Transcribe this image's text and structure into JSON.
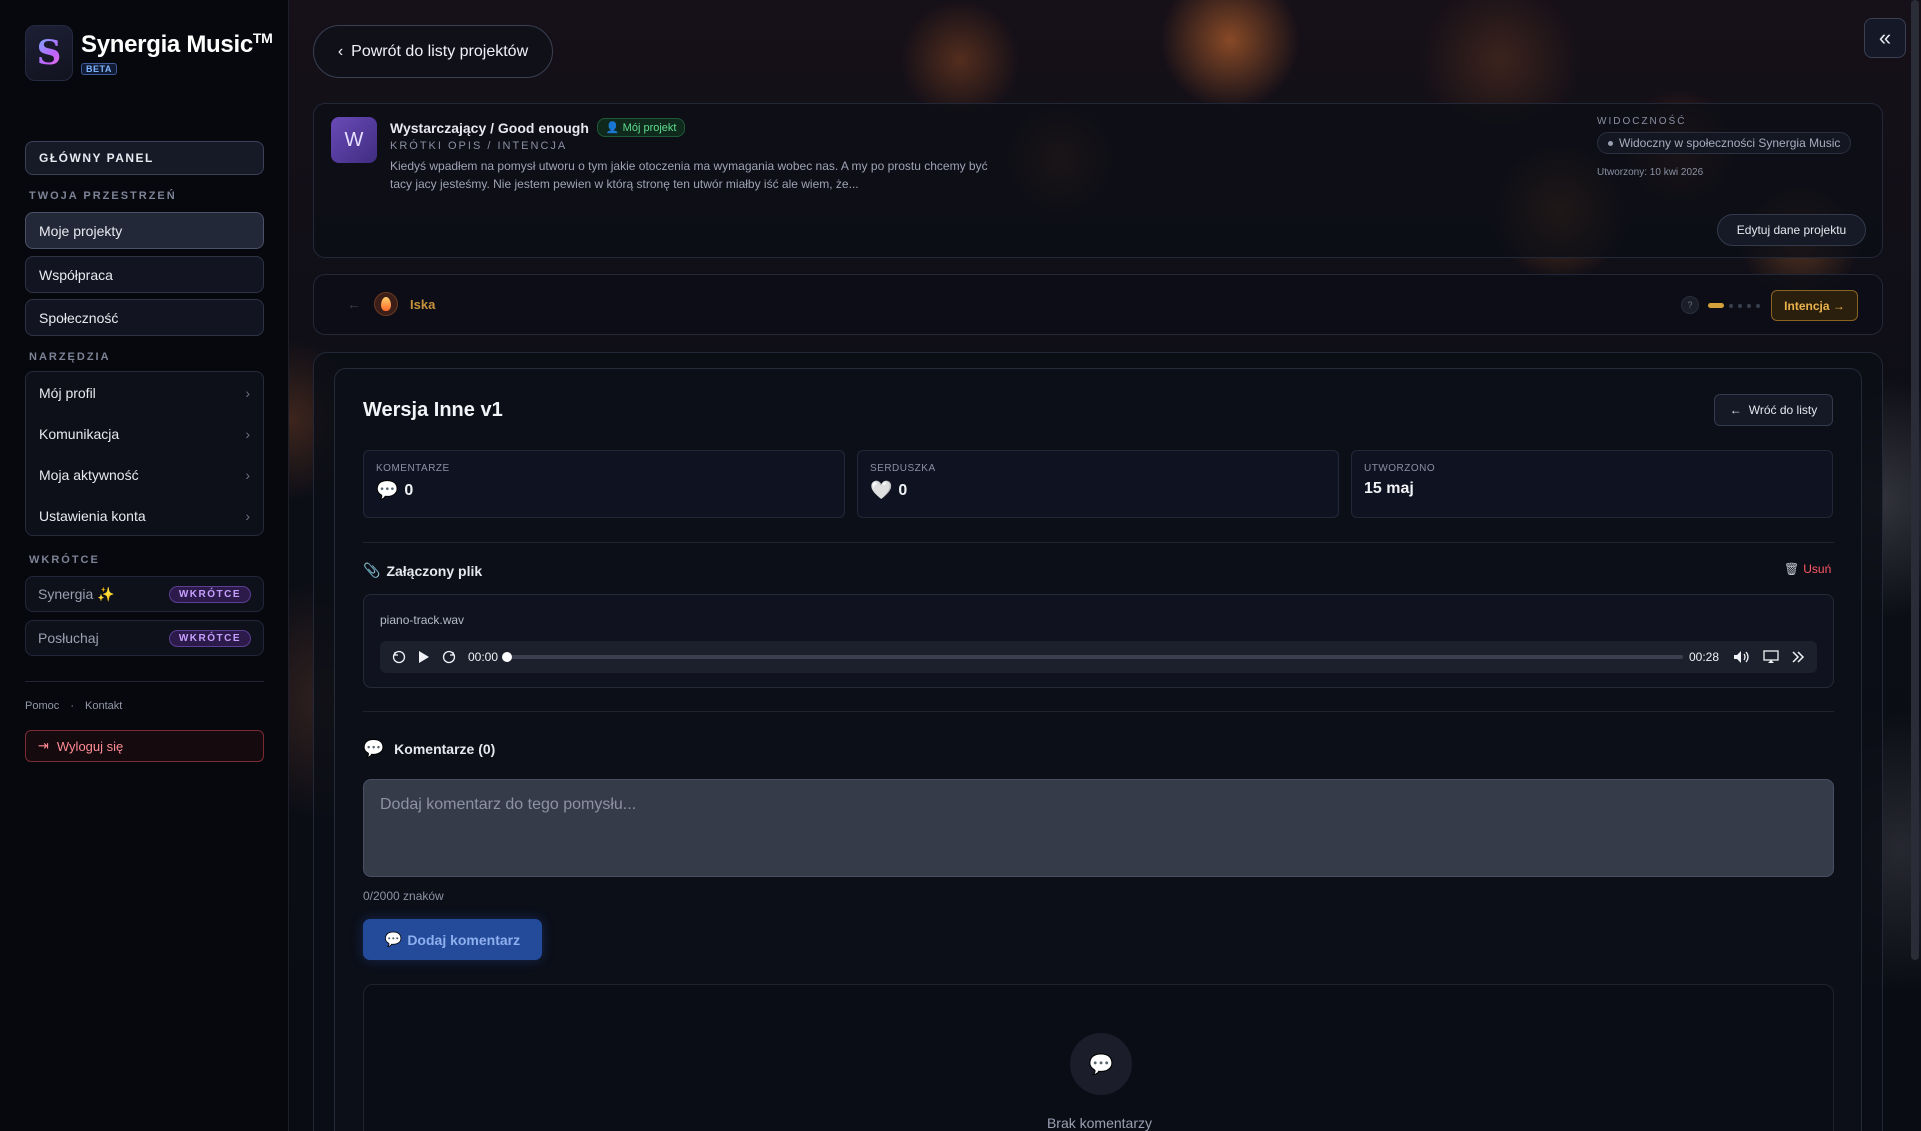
{
  "brand": {
    "logo_letter": "S",
    "logo_subtext": "Synergia",
    "name": "Synergia Music",
    "tm": "TM",
    "beta": "BETA"
  },
  "sidebar": {
    "main_panel": "GŁÓWNY PANEL",
    "workspace_label": "TWOJA PRZESTRZEŃ",
    "workspace_items": [
      {
        "label": "Moje projekty",
        "active": true
      },
      {
        "label": "Współpraca"
      },
      {
        "label": "Społeczność"
      }
    ],
    "tools_label": "NARZĘDZIA",
    "tools": [
      {
        "label": "Mój profil"
      },
      {
        "label": "Komunikacja"
      },
      {
        "label": "Moja aktywność"
      },
      {
        "label": "Ustawienia konta"
      }
    ],
    "soon_label": "WKRÓTCE",
    "soon_items": [
      {
        "label": "Synergia ✨",
        "badge": "WKRÓTCE"
      },
      {
        "label": "Posłuchaj",
        "badge": "WKRÓTCE"
      }
    ],
    "footer_links": [
      "Pomoc",
      "·",
      "Kontakt"
    ],
    "logout": "Wyloguj się"
  },
  "header": {
    "back_label": "Powrót do listy projektów",
    "collapse_icon": "double-chevron-left-icon"
  },
  "project": {
    "avatar_letter": "W",
    "title": "Wystarczający / Good enough",
    "owner_badge": "Mój projekt",
    "subtitle": "KRÓTKI OPIS / INTENCJA",
    "description": "Kiedyś wpadłem na pomysł utworu o tym jakie otoczenia ma wymagania wobec nas. A my po prostu chcemy być tacy jacy jesteśmy. Nie jestem pewien w którą stronę ten utwór miałby iść ale wiem, że...",
    "visibility_label": "WIDOCZNOŚĆ",
    "visibility_value": "Widoczny w społeczności Synergia Music",
    "created": "Utworzony: 10 kwi 2026",
    "edit_label": "Edytuj dane projektu"
  },
  "stage": {
    "prev": "←",
    "name": "Iska",
    "help": "?",
    "next_label": "Intencja →"
  },
  "version": {
    "title": "Wersja Inne v1",
    "back_label": "Wróć do listy",
    "stats": [
      {
        "label": "KOMENTARZE",
        "icon": "💬",
        "value": "0"
      },
      {
        "label": "SERDUSZKA",
        "icon": "🤍",
        "value": "0"
      },
      {
        "label": "UTWORZONO",
        "icon": "",
        "value": "15 maj"
      }
    ],
    "attachment_title": "Załączony plik",
    "delete_label": "Usuń",
    "file_name": "piano-track.wav",
    "player": {
      "current": "00:00",
      "duration": "00:28",
      "progress": 0
    },
    "comments_title": "Komentarze (0)",
    "comment_placeholder": "Dodaj komentarz do tego pomysłu...",
    "char_count": "0/2000 znaków",
    "add_comment_label": "Dodaj komentarz",
    "empty_text": "Brak komentarzy"
  }
}
